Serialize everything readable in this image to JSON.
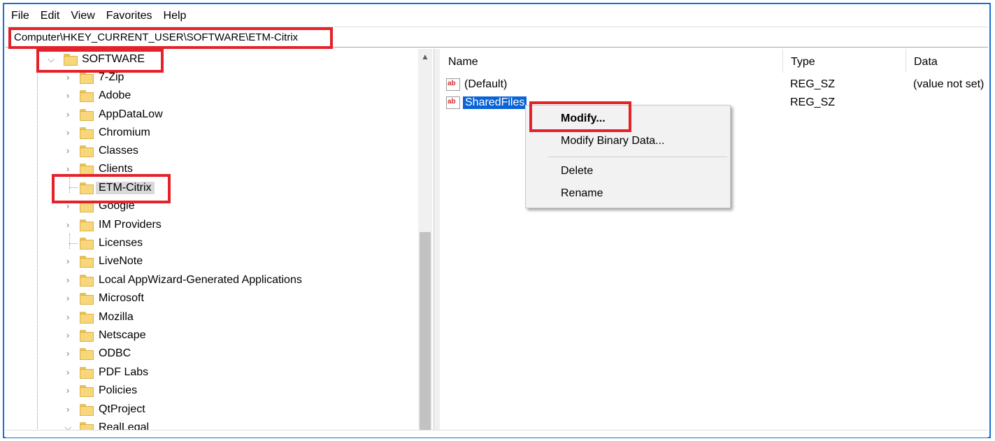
{
  "menubar": {
    "items": [
      "File",
      "Edit",
      "View",
      "Favorites",
      "Help"
    ]
  },
  "address": {
    "path": "Computer\\HKEY_CURRENT_USER\\SOFTWARE\\ETM-Citrix"
  },
  "tree": {
    "root": {
      "label": "SOFTWARE",
      "expanded": true
    },
    "items": [
      {
        "label": "7-Zip",
        "has_children": true
      },
      {
        "label": "Adobe",
        "has_children": true
      },
      {
        "label": "AppDataLow",
        "has_children": true
      },
      {
        "label": "Chromium",
        "has_children": true
      },
      {
        "label": "Classes",
        "has_children": true
      },
      {
        "label": "Clients",
        "has_children": true
      },
      {
        "label": "ETM-Citrix",
        "has_children": false,
        "selected": true
      },
      {
        "label": "Google",
        "has_children": true
      },
      {
        "label": "IM Providers",
        "has_children": true
      },
      {
        "label": "Licenses",
        "has_children": false
      },
      {
        "label": "LiveNote",
        "has_children": true
      },
      {
        "label": "Local AppWizard-Generated Applications",
        "has_children": true
      },
      {
        "label": "Microsoft",
        "has_children": true
      },
      {
        "label": "Mozilla",
        "has_children": true
      },
      {
        "label": "Netscape",
        "has_children": true
      },
      {
        "label": "ODBC",
        "has_children": true
      },
      {
        "label": "PDF Labs",
        "has_children": true
      },
      {
        "label": "Policies",
        "has_children": true
      },
      {
        "label": "QtProject",
        "has_children": true
      },
      {
        "label": "RealLegal",
        "has_children": true
      }
    ]
  },
  "list": {
    "columns": {
      "name": "Name",
      "type": "Type",
      "data": "Data"
    },
    "rows": [
      {
        "icon": "ab",
        "name": "(Default)",
        "type": "REG_SZ",
        "data": "(value not set)"
      },
      {
        "icon": "ab",
        "name": "SharedFiles",
        "type": "REG_SZ",
        "data": "",
        "selected": true
      }
    ]
  },
  "context_menu": {
    "items": [
      {
        "label": "Modify...",
        "bold": true
      },
      {
        "label": "Modify Binary Data..."
      },
      {
        "label": "Delete"
      },
      {
        "label": "Rename"
      }
    ]
  },
  "colors": {
    "highlight_box": "#e3222a",
    "selection": "#0a64d6",
    "frame": "#1a6fd1"
  }
}
